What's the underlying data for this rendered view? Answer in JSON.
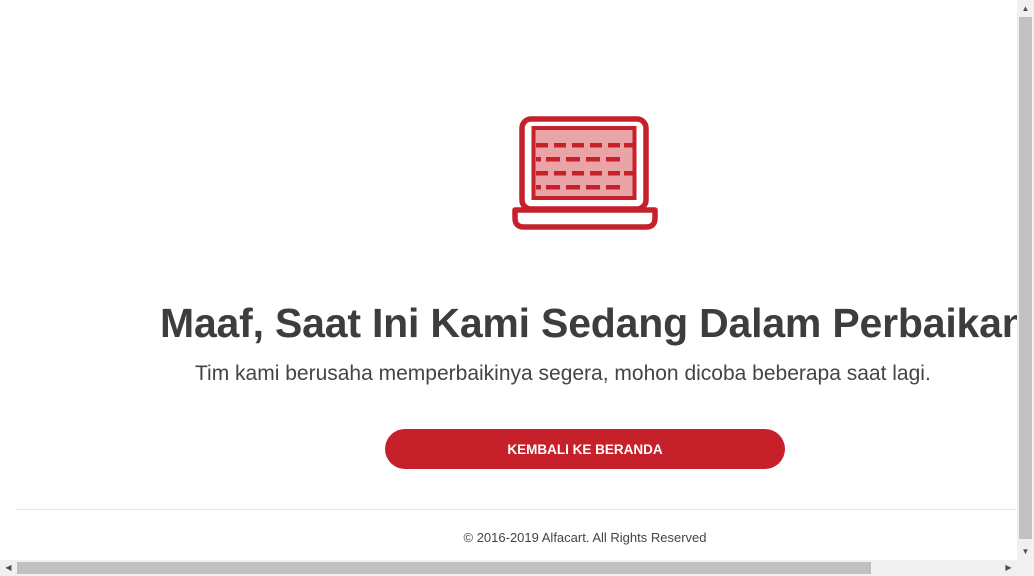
{
  "page": {
    "title": "Maaf, Saat Ini Kami Sedang Dalam Perbaikan",
    "subtitle": "Tim kami berusaha memperbaikinya segera, mohon dicoba beberapa saat lagi.",
    "button_label": "KEMBALI KE BERANDA",
    "footer": "© 2016-2019 Alfacart. All Rights Reserved"
  },
  "illustration": {
    "icon": "laptop-brick-wall-icon"
  },
  "scrollbars": {
    "vertical": {
      "up_icon": "▲",
      "down_icon": "▼"
    },
    "horizontal": {
      "left_icon": "◀",
      "right_icon": "▶"
    }
  },
  "colors": {
    "accent": "#c6202a",
    "brick_light": "#eaa3a7",
    "text": "#3d3d3d"
  }
}
